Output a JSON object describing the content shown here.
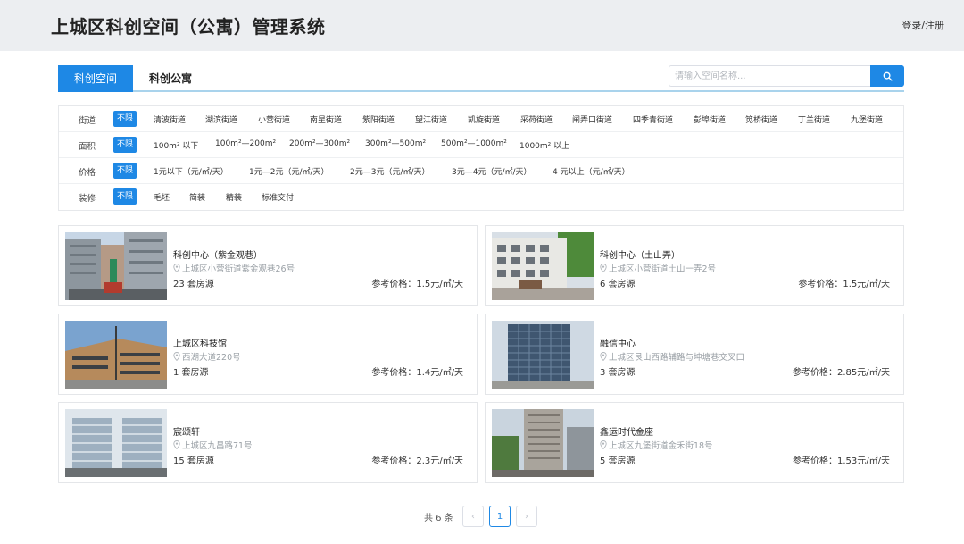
{
  "header": {
    "title": "上城区科创空间（公寓）管理系统",
    "login": "登录/注册"
  },
  "tabs": [
    {
      "label": "科创空间",
      "active": true
    },
    {
      "label": "科创公寓",
      "active": false
    }
  ],
  "search": {
    "placeholder": "请输入空间名称..."
  },
  "filters": {
    "street": {
      "label": "街道",
      "options": [
        "不限",
        "清波街道",
        "湖滨街道",
        "小营街道",
        "南星街道",
        "紫阳街道",
        "望江街道",
        "凯旋街道",
        "采荷街道",
        "闸弄口街道",
        "四季青街道",
        "彭埠街道",
        "笕桥街道",
        "丁兰街道",
        "九堡街道"
      ]
    },
    "area": {
      "label": "面积",
      "options": [
        "不限",
        "100m² 以下",
        "100m²—200m²",
        "200m²—300m²",
        "300m²—500m²",
        "500m²—1000m²",
        "1000m² 以上"
      ]
    },
    "price": {
      "label": "价格",
      "options": [
        "不限",
        "1元以下（元/㎡/天）",
        "1元—2元（元/㎡/天）",
        "2元—3元（元/㎡/天）",
        "3元—4元（元/㎡/天）",
        "4 元以上（元/㎡/天）"
      ]
    },
    "decor": {
      "label": "装修",
      "options": [
        "不限",
        "毛坯",
        "简装",
        "精装",
        "标准交付"
      ]
    }
  },
  "listings": [
    {
      "name": "科创中心（紫金观巷）",
      "address": "上城区小营街道紫金观巷26号",
      "count": "23 套房源",
      "price": "参考价格：1.5元/㎡/天"
    },
    {
      "name": "科创中心（土山弄）",
      "address": "上城区小营街道土山一弄2号",
      "count": "6 套房源",
      "price": "参考价格：1.5元/㎡/天"
    },
    {
      "name": "上城区科技馆",
      "address": "西湖大道220号",
      "count": "1 套房源",
      "price": "参考价格：1.4元/㎡/天"
    },
    {
      "name": "融信中心",
      "address": "上城区艮山西路辅路与坤塘巷交叉口",
      "count": "3 套房源",
      "price": "参考价格：2.85元/㎡/天"
    },
    {
      "name": "宸颂轩",
      "address": "上城区九昌路71号",
      "count": "15 套房源",
      "price": "参考价格：2.3元/㎡/天"
    },
    {
      "name": "鑫运时代金座",
      "address": "上城区九堡街道金禾街18号",
      "count": "5 套房源",
      "price": "参考价格：1.53元/㎡/天"
    }
  ],
  "pagination": {
    "total": "共 6 条",
    "current": "1",
    "prev": "‹",
    "next": "›"
  },
  "colors": {
    "accent": "#1e88e5",
    "header_bg": "#eceef1",
    "muted": "#9aa0a6"
  },
  "icons": {
    "search": "search-icon",
    "location": "location-pin-icon"
  }
}
